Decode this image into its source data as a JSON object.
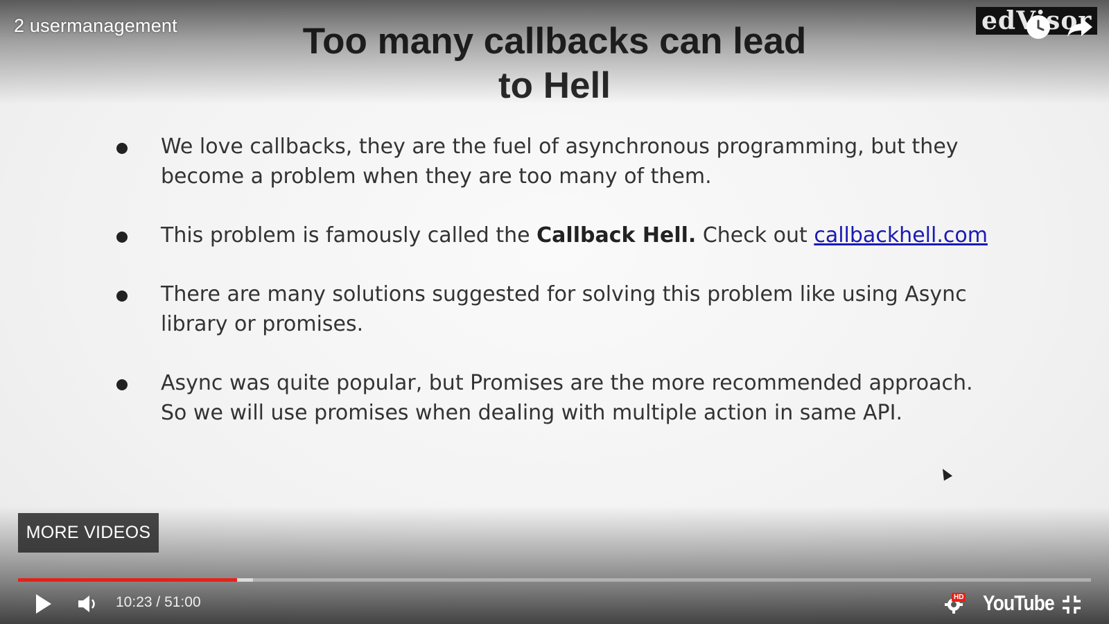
{
  "player": {
    "video_title": "2 usermanagement",
    "channel_logo_text": "edVisor",
    "watch_later_icon": "clock-icon",
    "share_icon": "share-arrow-icon",
    "more_videos_label": "MORE VIDEOS",
    "time_current": "10:23",
    "time_separator": " / ",
    "time_total": "51:00",
    "progress_played_fraction": 0.204,
    "progress_buffered_fraction": 0.219,
    "progress_color": "#e62117",
    "hd_badge": "HD",
    "youtube_logo": "YouTube",
    "icons": {
      "play": "play-icon",
      "volume": "volume-icon",
      "settings": "gear-icon",
      "exit_fullscreen": "exit-fullscreen-icon"
    }
  },
  "slide": {
    "title_line1": "Too many callbacks can lead",
    "title_line2": "to Hell",
    "bullets": [
      {
        "text": "We love callbacks, they are the fuel of asynchronous programming, but they become a problem when they are too many of them."
      },
      {
        "text_before": "This problem is famously called the ",
        "bold": "Callback Hell.",
        "text_after": " Check out ",
        "link": "callbackhell.com"
      },
      {
        "text": "There are many solutions suggested for solving this problem like using Async library or promises."
      },
      {
        "text": "Async was quite popular, but Promises are the more recommended approach. So we will use promises when dealing with multiple action in same API."
      }
    ]
  }
}
